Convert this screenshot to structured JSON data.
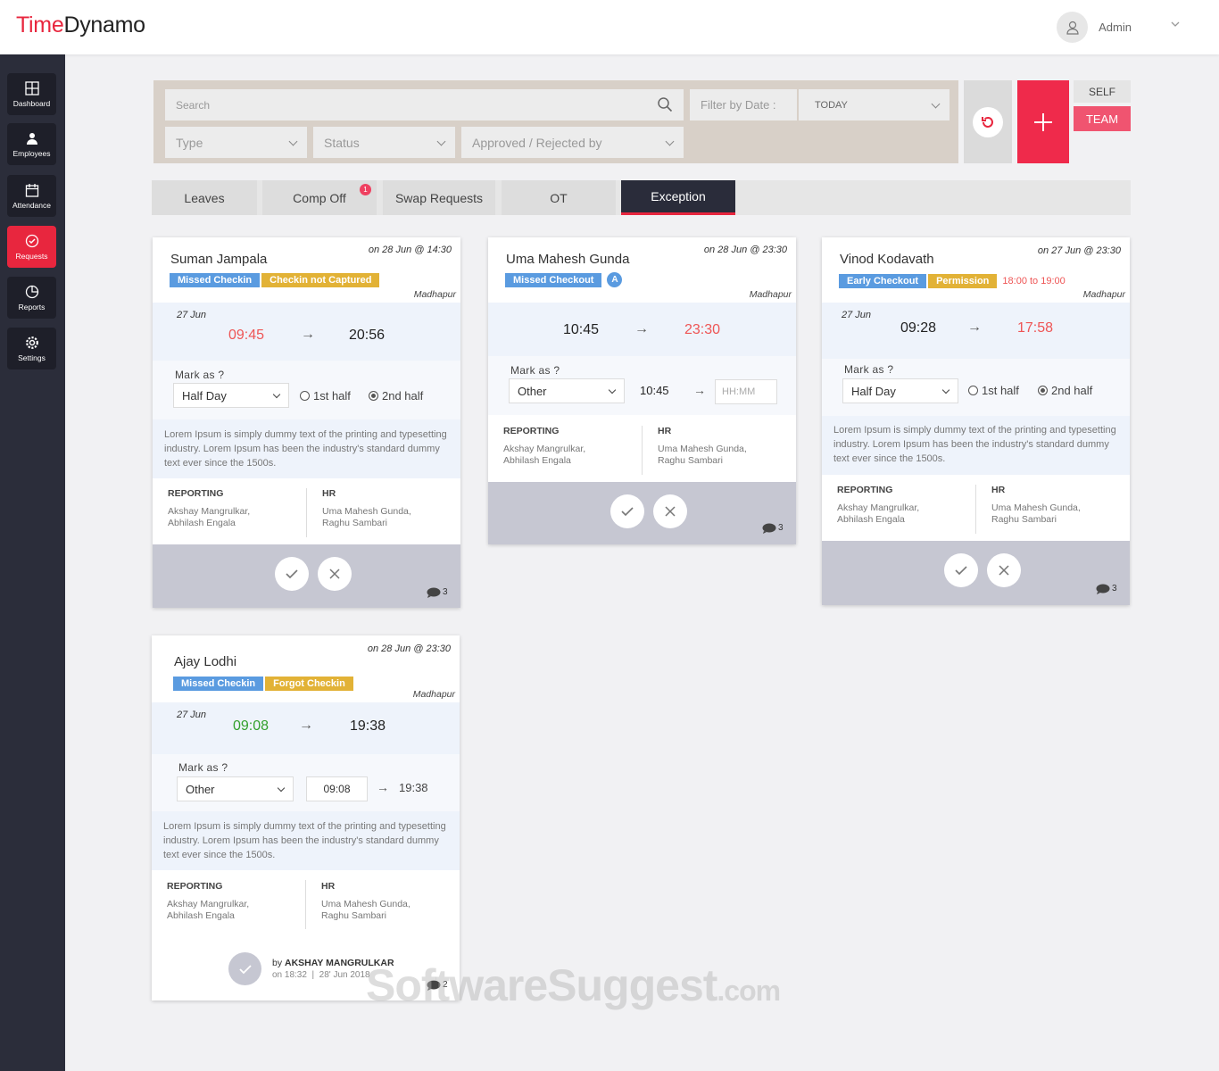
{
  "app": {
    "logo_part1": "Time",
    "logo_part2": "Dynamo",
    "user": "Admin"
  },
  "sidebar": [
    {
      "label": "Dashboard",
      "icon": "dashboard-icon"
    },
    {
      "label": "Employees",
      "icon": "employees-icon"
    },
    {
      "label": "Attendance",
      "icon": "calendar-icon"
    },
    {
      "label": "Requests",
      "icon": "check-circle-icon",
      "active": true
    },
    {
      "label": "Reports",
      "icon": "pie-chart-icon"
    },
    {
      "label": "Settings",
      "icon": "gear-icon"
    }
  ],
  "filters": {
    "search_placeholder": "Search",
    "filter_by_date_label": "Filter by Date :",
    "date_value": "TODAY",
    "type": "Type",
    "status": "Status",
    "approved_rejected_by": "Approved / Rejected by"
  },
  "scope": {
    "self": "SELF",
    "team": "TEAM"
  },
  "tabs": [
    {
      "label": "Leaves"
    },
    {
      "label": "Comp Off",
      "badge": "1"
    },
    {
      "label": "Swap Requests"
    },
    {
      "label": "OT"
    },
    {
      "label": "Exception",
      "active": true
    }
  ],
  "cards": [
    {
      "name": "Suman Jampala",
      "timestamp": "on 28 Jun @ 14:30",
      "tags": [
        "Missed Checkin",
        "Checkin not Captured"
      ],
      "location": "Madhapur",
      "date": "27 Jun",
      "time_in": "09:45",
      "time_out": "20:56",
      "mark_as_label": "Mark  as ?",
      "mark_value": "Half Day",
      "radio1": "1st half",
      "radio2": "2nd half",
      "description": "Lorem Ipsum is simply dummy text of the printing and typesetting industry. Lorem Ipsum has been the industry's standard dummy text ever since the 1500s.",
      "reporting_label": "REPORTING",
      "reporting_names": "Akshay Mangrulkar,\nAbhilash Engala",
      "hr_label": "HR",
      "hr_names": "Uma Mahesh Gunda,\nRaghu Sambari",
      "comments": "3"
    },
    {
      "name": "Uma Mahesh Gunda",
      "timestamp": "on 28 Jun @ 23:30",
      "tags": [
        "Missed Checkout"
      ],
      "badge": "A",
      "location": "Madhapur",
      "time_in": "10:45",
      "time_out": "23:30",
      "mark_as_label": "Mark  as ?",
      "mark_value": "Other",
      "edit_in": "10:45",
      "edit_out_placeholder": "HH:MM",
      "reporting_label": "REPORTING",
      "reporting_names": "Akshay Mangrulkar,\nAbhilash Engala",
      "hr_label": "HR",
      "hr_names": "Uma Mahesh Gunda,\nRaghu Sambari",
      "comments": "3"
    },
    {
      "name": "Vinod Kodavath",
      "timestamp": "on 27 Jun @ 23:30",
      "tags": [
        "Early Checkout",
        "Permission"
      ],
      "permission_time": "18:00 to 19:00",
      "location": "Madhapur",
      "date": "27 Jun",
      "time_in": "09:28",
      "time_out": "17:58",
      "mark_as_label": "Mark  as ?",
      "mark_value": "Half Day",
      "radio1": "1st half",
      "radio2": "2nd half",
      "description": "Lorem Ipsum is simply dummy text of the printing and typesetting industry. Lorem Ipsum has been the industry's standard dummy text ever since the 1500s.",
      "reporting_label": "REPORTING",
      "reporting_names": "Akshay Mangrulkar,\nAbhilash Engala",
      "hr_label": "HR",
      "hr_names": "Uma Mahesh Gunda,\nRaghu Sambari",
      "comments": "3"
    },
    {
      "name": "Ajay Lodhi",
      "timestamp": "on 28 Jun @ 23:30",
      "tags": [
        "Missed Checkin",
        "Forgot Checkin"
      ],
      "location": "Madhapur",
      "date": "27 Jun",
      "time_in": "09:08",
      "time_out": "19:38",
      "mark_as_label": "Mark  as ?",
      "mark_value": "Other",
      "edit_in": "09:08",
      "edit_out": "19:38",
      "description": "Lorem Ipsum is simply dummy text of the printing and typesetting industry. Lorem Ipsum has been the industry's standard dummy text ever since the 1500s.",
      "reporting_label": "REPORTING",
      "reporting_names": "Akshay Mangrulkar,\nAbhilash Engala",
      "hr_label": "HR",
      "hr_names": "Uma Mahesh Gunda,\nRaghu Sambari",
      "approved_by_prefix": "by",
      "approved_by": "AKSHAY MANGRULKAR",
      "approved_on": "on 18:32  |  28' Jun 2018",
      "comments": "2"
    }
  ],
  "watermark": {
    "main": "SoftwareSuggest",
    "suffix": ".com"
  },
  "colors": {
    "accent": "#e8263e",
    "sidebar": "#2b2d3a",
    "tag_blue": "#5a9be0",
    "tag_gold": "#e2b236"
  }
}
